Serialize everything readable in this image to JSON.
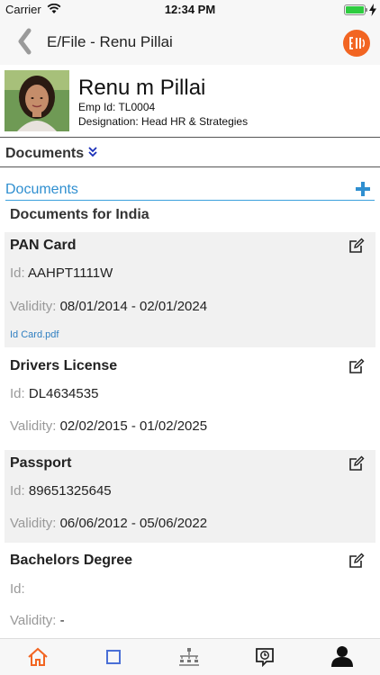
{
  "status_bar": {
    "carrier": "Carrier",
    "time": "12:34 PM",
    "battery_level": 1.0
  },
  "nav": {
    "back_icon": "back-chevron-icon",
    "title": "E/File - Renu Pillai",
    "logo_icon": "app-logo-icon",
    "logo_color": "#f26522"
  },
  "profile": {
    "name": "Renu m Pillai",
    "emp_id": "Emp Id: TL0004",
    "designation": "Designation: Head HR & Strategies"
  },
  "section": {
    "title": "Documents",
    "chevron_icon": "double-chevron-down-icon"
  },
  "documents": {
    "header": "Documents",
    "add_icon": "plus-icon",
    "accent_color": "#2f8fd0",
    "subheader": "Documents for India",
    "id_label": "Id:",
    "validity_label": "Validity:",
    "items": [
      {
        "title": "PAN Card",
        "id": "AAHPT1111W",
        "validity": "08/01/2014 - 02/01/2024",
        "attachment": "Id Card.pdf"
      },
      {
        "title": "Drivers License",
        "id": "DL4634535",
        "validity": "02/02/2015 - 01/02/2025"
      },
      {
        "title": "Passport",
        "id": "89651325645",
        "validity": "06/06/2012 - 05/06/2022"
      },
      {
        "title": "Bachelors Degree",
        "id": "",
        "validity": "-"
      }
    ]
  },
  "tab_bar": {
    "tabs": [
      {
        "icon": "home-icon",
        "active": true,
        "active_color": "#f26522"
      },
      {
        "icon": "square-icon",
        "active": false
      },
      {
        "icon": "org-chart-icon",
        "active": false
      },
      {
        "icon": "timesheet-icon",
        "active": false
      },
      {
        "icon": "profile-icon",
        "active": false
      }
    ]
  }
}
